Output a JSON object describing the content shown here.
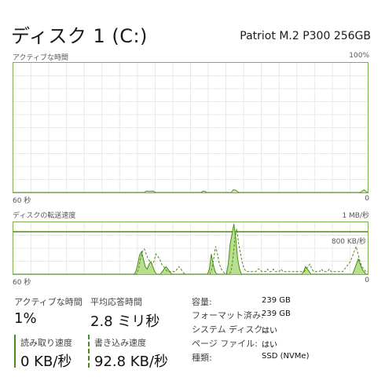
{
  "header": {
    "title": "ディスク 1 (C:)",
    "model": "Patriot M.2 P300 256GB"
  },
  "active_graph": {
    "label": "アクティブな時間",
    "max_label": "100%",
    "time_label": "60 秒",
    "min_label": "0",
    "color": "#7eae4f",
    "values": [
      0,
      0,
      0,
      0,
      0,
      0,
      0,
      0,
      0,
      0,
      0,
      0,
      0,
      0,
      0,
      0,
      0,
      0,
      0,
      0,
      0,
      0,
      0,
      0,
      0,
      0,
      0,
      0,
      0,
      0,
      0,
      0,
      0,
      0,
      0,
      0,
      0,
      0,
      0,
      0,
      0,
      0,
      0,
      0,
      0,
      0,
      0,
      0,
      0,
      0,
      0,
      0,
      0,
      0,
      0,
      0,
      0,
      0,
      0,
      0,
      0,
      0,
      0,
      0,
      0,
      0,
      0,
      0,
      0,
      0,
      1,
      1,
      1,
      1,
      1,
      0,
      0,
      0,
      0,
      0,
      0,
      0,
      0,
      0,
      0,
      0,
      0,
      0,
      0,
      0,
      0,
      0,
      0,
      0,
      0,
      0,
      0,
      0,
      0,
      0,
      1,
      1,
      0,
      0,
      0,
      0,
      0,
      0,
      0,
      0,
      0,
      0,
      0,
      0,
      0,
      0,
      2,
      2,
      1,
      0,
      0,
      0,
      0,
      0,
      0,
      0,
      0,
      0,
      0,
      0,
      0,
      0,
      0,
      0,
      0,
      0,
      0,
      0,
      0,
      0,
      0,
      0,
      0,
      0,
      0,
      0,
      0,
      0,
      0,
      0,
      0,
      0,
      0,
      0,
      0,
      0,
      0,
      0,
      0,
      0,
      0,
      0,
      0,
      0,
      0,
      0,
      0,
      0,
      0,
      0,
      0,
      0,
      0,
      0,
      0,
      0,
      0,
      0,
      0,
      0,
      0,
      0,
      0,
      0,
      1,
      2,
      1,
      0
    ]
  },
  "transfer_graph": {
    "label": "ディスクの転送速度",
    "max_label": "1 MB/秒",
    "scale_label": "800 KB/秒",
    "time_label": "60 秒",
    "min_label": "0",
    "color": "#7eae4f",
    "read_values": [
      0,
      0,
      0,
      0,
      0,
      0,
      0,
      0,
      0,
      0,
      0,
      0,
      0,
      0,
      0,
      0,
      0,
      0,
      0,
      0,
      0,
      0,
      0,
      0,
      0,
      0,
      0,
      0,
      0,
      0,
      0,
      0,
      0,
      0,
      0,
      0,
      0,
      0,
      0,
      0,
      0,
      0,
      0,
      0,
      0,
      0,
      0,
      0,
      0,
      0,
      0,
      0,
      0,
      0,
      0,
      0,
      0,
      0,
      0,
      0,
      0,
      0,
      0,
      0,
      0,
      5,
      20,
      38,
      45,
      30,
      15,
      10,
      20,
      25,
      15,
      5,
      0,
      0,
      0,
      5,
      10,
      15,
      10,
      5,
      0,
      0,
      0,
      0,
      0,
      0,
      0,
      0,
      0,
      0,
      0,
      0,
      0,
      0,
      0,
      0,
      0,
      0,
      0,
      0,
      10,
      40,
      20,
      5,
      0,
      0,
      0,
      0,
      0,
      0,
      20,
      60,
      80,
      100,
      70,
      30,
      10,
      0,
      0,
      0,
      0,
      0,
      0,
      0,
      0,
      0,
      0,
      0,
      0,
      0,
      0,
      0,
      0,
      0,
      0,
      0,
      0,
      0,
      0,
      0,
      0,
      0,
      0,
      0,
      0,
      0,
      0,
      0,
      0,
      0,
      5,
      15,
      10,
      5,
      0,
      0,
      0,
      0,
      0,
      0,
      0,
      0,
      0,
      0,
      0,
      0,
      0,
      0,
      0,
      0,
      0,
      0,
      0,
      0,
      0,
      0,
      0,
      10,
      20,
      30,
      20,
      10,
      5,
      0,
      0
    ],
    "write_values": [
      0,
      0,
      0,
      0,
      0,
      0,
      0,
      0,
      0,
      0,
      0,
      0,
      0,
      0,
      0,
      0,
      0,
      0,
      0,
      0,
      0,
      0,
      0,
      0,
      0,
      0,
      0,
      0,
      0,
      0,
      0,
      0,
      0,
      0,
      0,
      0,
      0,
      0,
      0,
      0,
      0,
      0,
      0,
      0,
      0,
      0,
      0,
      0,
      0,
      0,
      0,
      0,
      0,
      0,
      0,
      0,
      0,
      0,
      0,
      0,
      0,
      0,
      0,
      0,
      0,
      10,
      30,
      45,
      50,
      40,
      30,
      25,
      20,
      25,
      40,
      35,
      30,
      20,
      15,
      10,
      5,
      5,
      5,
      5,
      5,
      10,
      15,
      10,
      5,
      0,
      0,
      0,
      0,
      0,
      0,
      0,
      0,
      0,
      0,
      0,
      0,
      0,
      0,
      10,
      30,
      55,
      40,
      20,
      10,
      5,
      0,
      0,
      0,
      5,
      30,
      70,
      90,
      60,
      40,
      20,
      10,
      5,
      5,
      5,
      5,
      5,
      5,
      10,
      10,
      5,
      5,
      5,
      10,
      5,
      5,
      10,
      5,
      5,
      5,
      10,
      5,
      5,
      5,
      5,
      5,
      5,
      5,
      5,
      5,
      5,
      5,
      5,
      10,
      15,
      20,
      10,
      5,
      5,
      5,
      5,
      10,
      5,
      5,
      5,
      10,
      5,
      5,
      5,
      5,
      5,
      5,
      5,
      10,
      15,
      20,
      25,
      35,
      45,
      55,
      40,
      25,
      15,
      10,
      5,
      5
    ]
  },
  "stats": {
    "active_time_label": "アクティブな時間",
    "active_time_value": "1%",
    "avg_response_label": "平均応答時間",
    "avg_response_value": "2.8 ミリ秒",
    "read_speed_label": "読み取り速度",
    "read_speed_value": "0 KB/秒",
    "write_speed_label": "書き込み速度",
    "write_speed_value": "92.8 KB/秒"
  },
  "info": {
    "capacity_label": "容量:",
    "capacity_value": "239 GB",
    "formatted_label": "フォーマット済み:",
    "formatted_value": "239 GB",
    "system_disk_label": "システム ディスク:",
    "system_disk_value": "はい",
    "page_file_label": "ページ ファイル:",
    "page_file_value": "はい",
    "type_label": "種類:",
    "type_value": "SSD (NVMe)"
  }
}
